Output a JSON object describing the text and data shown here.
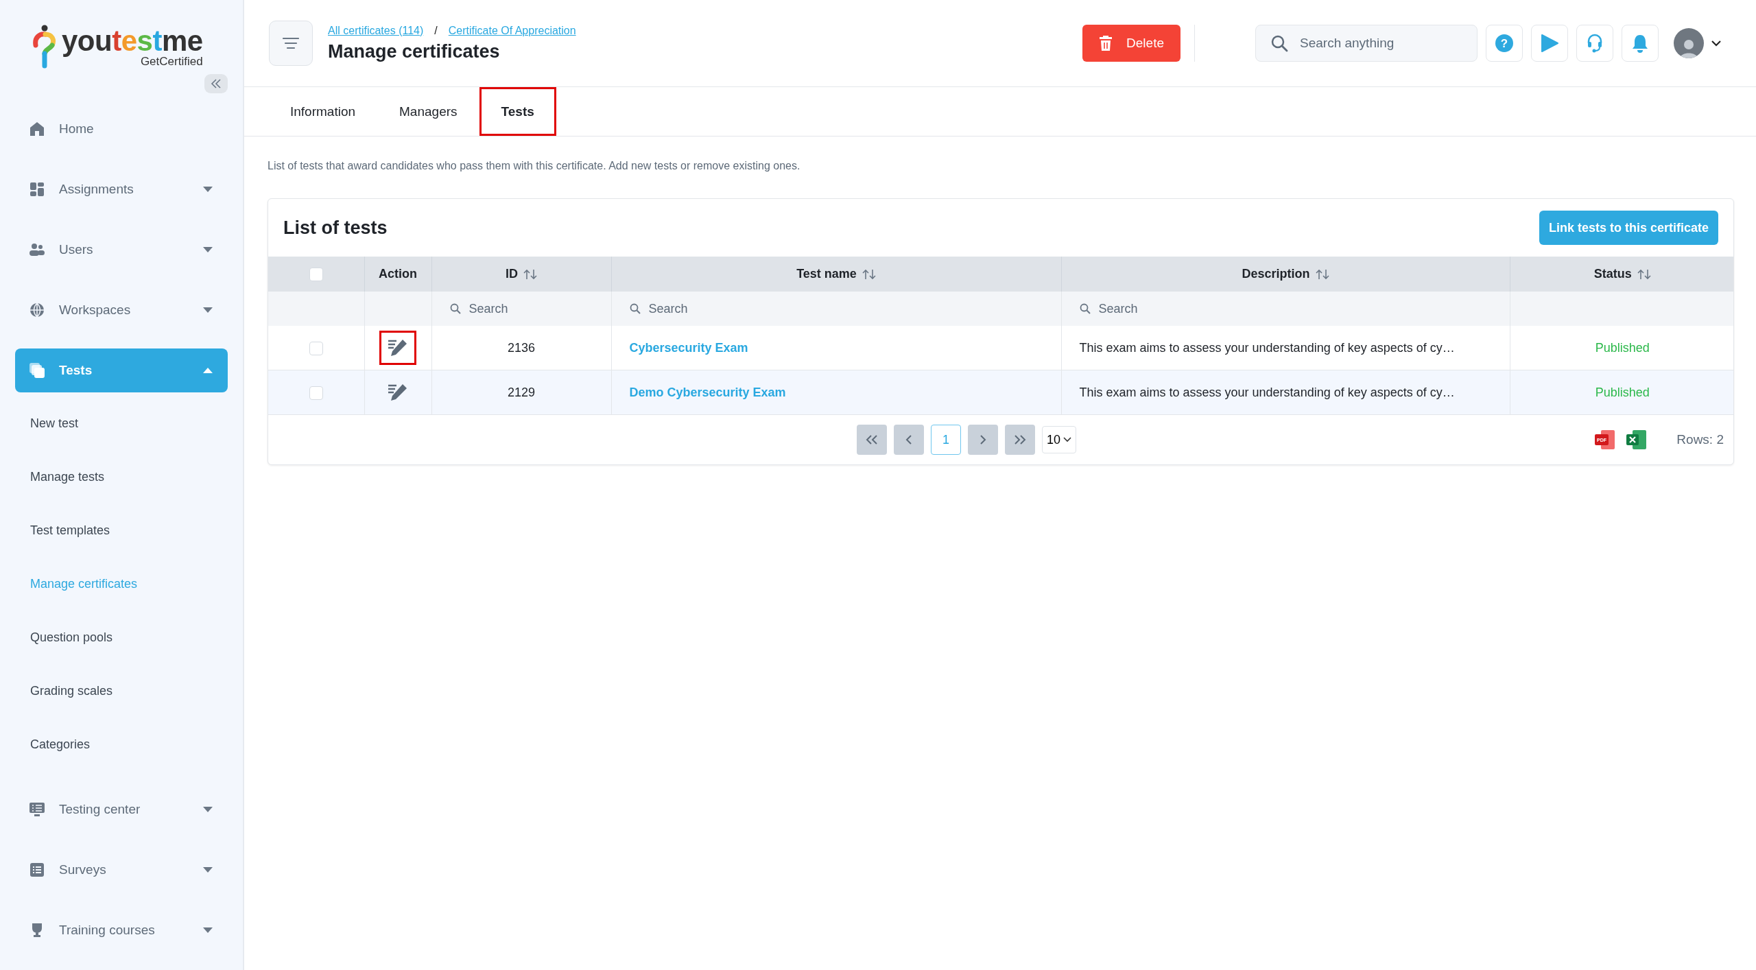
{
  "logo": {
    "segments": [
      {
        "text": "you",
        "color": "#333333"
      },
      {
        "text": "t",
        "color": "#d8412f"
      },
      {
        "text": "e",
        "color": "#f39a2b"
      },
      {
        "text": "s",
        "color": "#5cb947"
      },
      {
        "text": "t",
        "color": "#29a8e0"
      },
      {
        "text": "me",
        "color": "#333333"
      }
    ],
    "tagline": "GetCertified"
  },
  "sidebar": {
    "items": [
      {
        "label": "Home",
        "expandable": false,
        "selected": false
      },
      {
        "label": "Assignments",
        "expandable": true,
        "expanded": false,
        "selected": false
      },
      {
        "label": "Users",
        "expandable": true,
        "expanded": false,
        "selected": false
      },
      {
        "label": "Workspaces",
        "expandable": true,
        "expanded": false,
        "selected": false
      },
      {
        "label": "Tests",
        "expandable": true,
        "expanded": true,
        "selected": true,
        "children": [
          {
            "label": "New test",
            "selected": false
          },
          {
            "label": "Manage tests",
            "selected": false
          },
          {
            "label": "Test templates",
            "selected": false
          },
          {
            "label": "Manage certificates",
            "selected": true
          },
          {
            "label": "Question pools",
            "selected": false
          },
          {
            "label": "Grading scales",
            "selected": false
          },
          {
            "label": "Categories",
            "selected": false
          }
        ]
      },
      {
        "label": "Testing center",
        "expandable": true,
        "expanded": false,
        "selected": false
      },
      {
        "label": "Surveys",
        "expandable": true,
        "expanded": false,
        "selected": false
      },
      {
        "label": "Training courses",
        "expandable": true,
        "expanded": false,
        "selected": false
      }
    ]
  },
  "header": {
    "breadcrumbs": [
      "All certificates (114)",
      "Certificate Of Appreciation"
    ],
    "separator": "/",
    "title": "Manage certificates",
    "delete_button": "Delete",
    "search": {
      "placeholder": "Search anything"
    },
    "help_glyph": "?"
  },
  "tabs": [
    {
      "label": "Information",
      "selected": false,
      "highlighted": false
    },
    {
      "label": "Managers",
      "selected": false,
      "highlighted": false
    },
    {
      "label": "Tests",
      "selected": true,
      "highlighted": true
    }
  ],
  "intro": "List of tests that award candidates who pass them with this certificate. Add new tests or remove existing ones.",
  "card": {
    "title": "List of tests",
    "link_button": "Link tests to this certificate"
  },
  "table": {
    "select_all": {
      "checked": false
    },
    "columns": [
      {
        "label": "Action",
        "sortable": false
      },
      {
        "label": "ID",
        "sortable": true,
        "filter_placeholder": "Search"
      },
      {
        "label": "Test name",
        "sortable": true,
        "filter_placeholder": "Search"
      },
      {
        "label": "Description",
        "sortable": true,
        "filter_placeholder": "Search"
      },
      {
        "label": "Status",
        "sortable": true
      }
    ],
    "rows": [
      {
        "checked": false,
        "action_highlighted": true,
        "id": "2136",
        "name": "Cybersecurity Exam",
        "description": "This exam aims to assess your understanding of key aspects of cy…",
        "status": "Published"
      },
      {
        "checked": false,
        "action_highlighted": false,
        "id": "2129",
        "name": "Demo Cybersecurity Exam",
        "description": "This exam aims to assess your understanding of key aspects of cy…",
        "status": "Published"
      }
    ]
  },
  "pagination": {
    "pages": [
      {
        "label": "1",
        "selected": true
      }
    ],
    "page_size": "10",
    "rows_count": "Rows: 2",
    "pdf_label": "PDF"
  }
}
